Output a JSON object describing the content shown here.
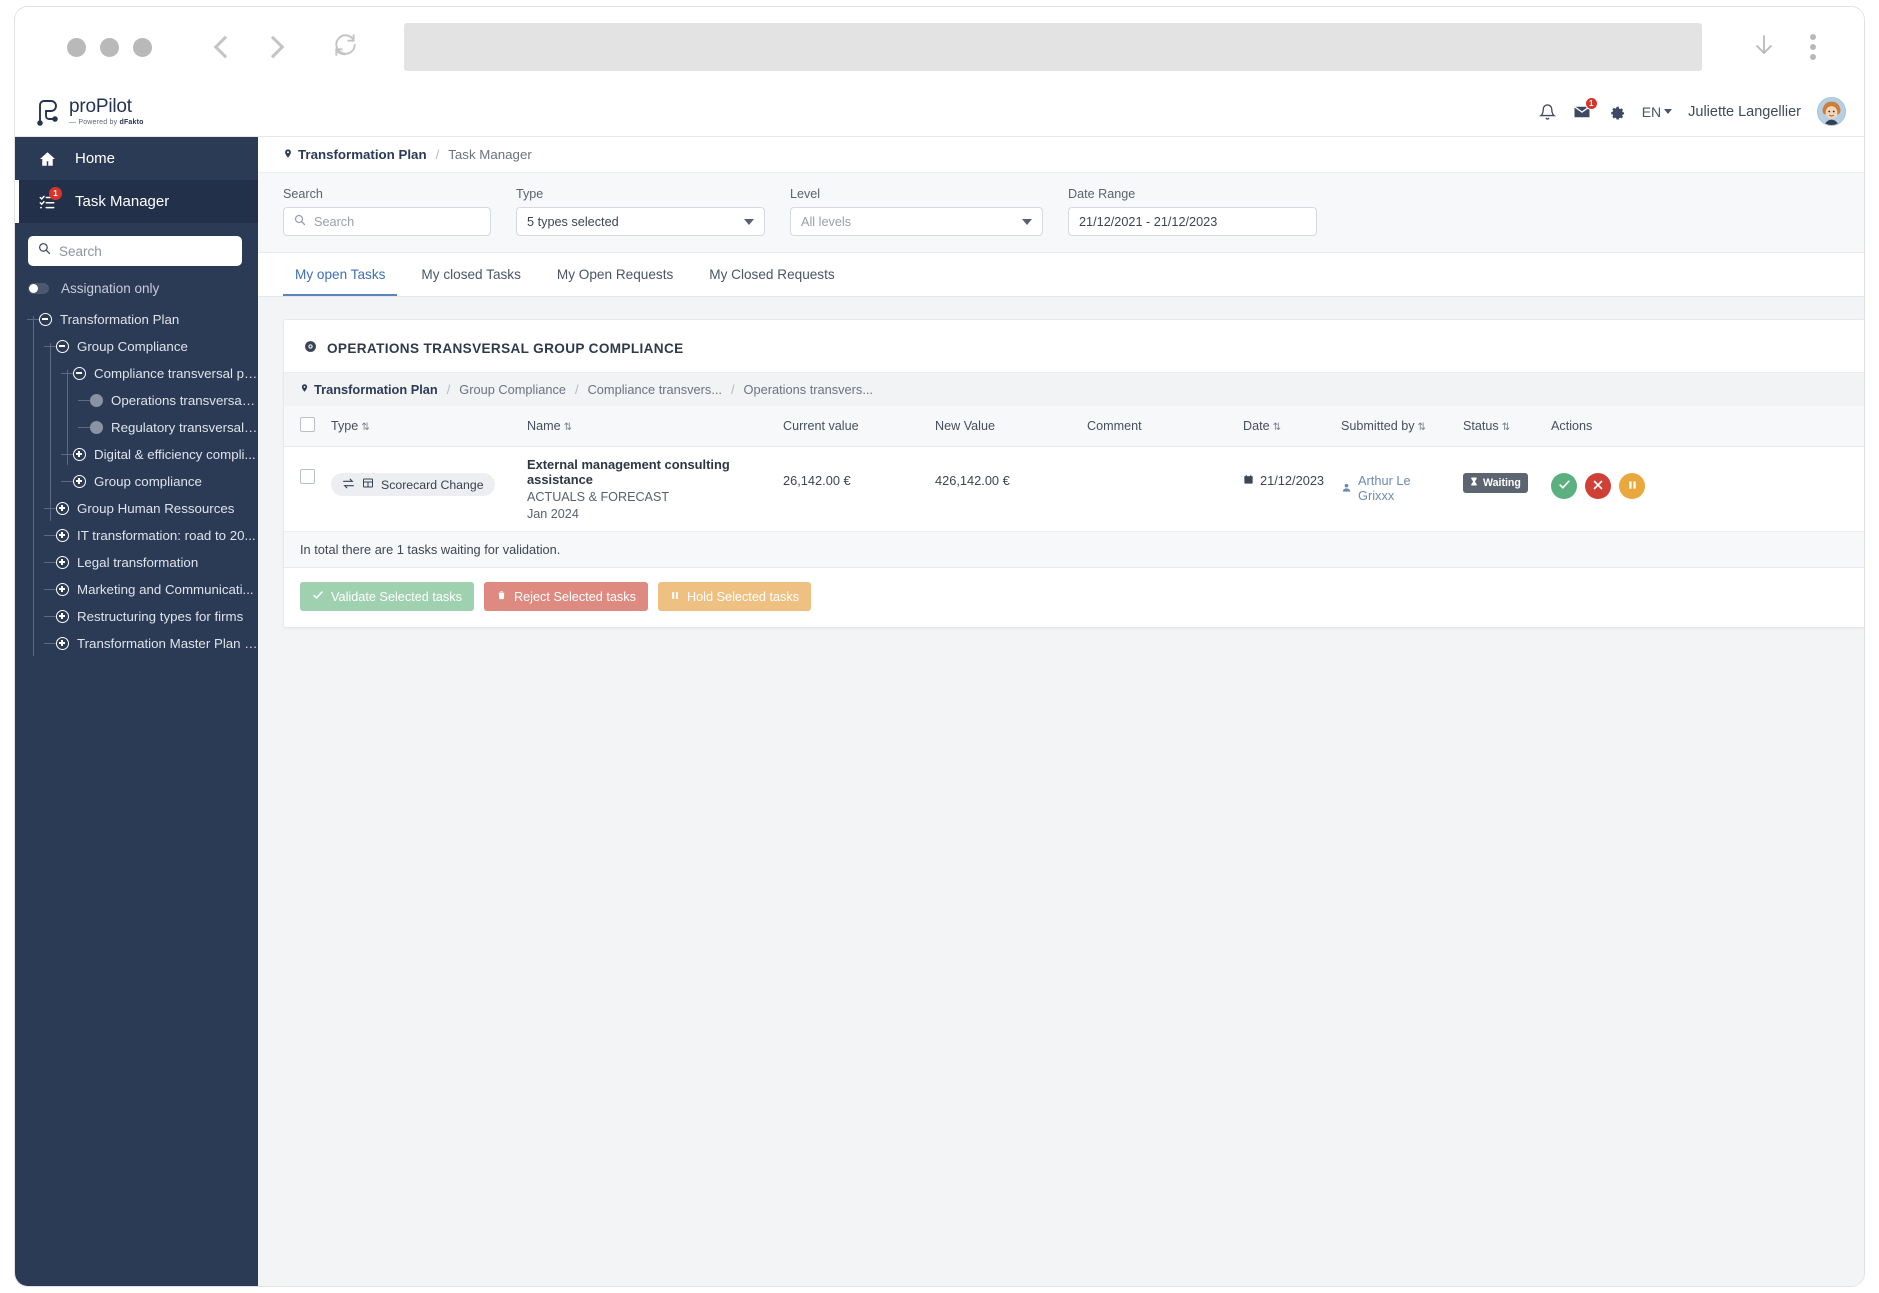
{
  "browser": {
    "back_label": "Back",
    "forward_label": "Forward",
    "reload_label": "Reload",
    "url_value": "",
    "download_label": "Downloads",
    "menu_label": "More"
  },
  "app": {
    "logo_name": "proPilot",
    "logo_sub_pre": "— Powered by ",
    "logo_sub_brand": "dFakto",
    "language": "EN",
    "username": "Juliette Langellier",
    "mail_badge": "1"
  },
  "sidebar": {
    "top_items": [
      {
        "label": "Home",
        "icon": "home-icon",
        "badge": ""
      },
      {
        "label": "Task Manager",
        "icon": "task-list-icon",
        "badge": "1"
      }
    ],
    "search_placeholder": "Search",
    "search_value": "",
    "assignation_label": "Assignation only",
    "tree": [
      {
        "label": "Transformation Plan",
        "depth": 0,
        "state": "minus"
      },
      {
        "label": "Group Compliance",
        "depth": 1,
        "state": "minus"
      },
      {
        "label": "Compliance transversal pr...",
        "depth": 2,
        "state": "minus"
      },
      {
        "label": "Operations transversal ...",
        "depth": 3,
        "state": "leaf"
      },
      {
        "label": "Regulatory transversal ...",
        "depth": 3,
        "state": "leaf"
      },
      {
        "label": "Digital & efficiency compli...",
        "depth": 2,
        "state": "plus"
      },
      {
        "label": "Group compliance",
        "depth": 2,
        "state": "plus"
      },
      {
        "label": "Group Human Ressources",
        "depth": 1,
        "state": "plus"
      },
      {
        "label": "IT transformation: road to 20...",
        "depth": 1,
        "state": "plus"
      },
      {
        "label": "Legal transformation",
        "depth": 1,
        "state": "plus"
      },
      {
        "label": "Marketing and Communicati...",
        "depth": 1,
        "state": "plus"
      },
      {
        "label": "Restructuring types for firms",
        "depth": 1,
        "state": "plus"
      },
      {
        "label": "Transformation Master Plan -...",
        "depth": 1,
        "state": "plus"
      }
    ]
  },
  "breadcrumb": {
    "root": "Transformation Plan",
    "sep": "/",
    "current": "Task Manager"
  },
  "filters": {
    "search": {
      "label": "Search",
      "placeholder": "Search",
      "value": ""
    },
    "type": {
      "label": "Type",
      "value": "5 types selected"
    },
    "level": {
      "label": "Level",
      "value": "All levels"
    },
    "date_range": {
      "label": "Date Range",
      "value": "21/12/2021 - 21/12/2023"
    }
  },
  "tabs": [
    {
      "label": "My open Tasks",
      "active": true
    },
    {
      "label": "My closed Tasks",
      "active": false
    },
    {
      "label": "My Open Requests",
      "active": false
    },
    {
      "label": "My Closed Requests",
      "active": false
    }
  ],
  "card": {
    "title": "OPERATIONS TRANSVERSAL GROUP COMPLIANCE",
    "breadcrumb": [
      "Transformation Plan",
      "Group Compliance",
      "Compliance transvers...",
      "Operations transvers..."
    ],
    "columns": [
      {
        "label": "Type",
        "sortable": true
      },
      {
        "label": "Name",
        "sortable": true
      },
      {
        "label": "Current value",
        "sortable": false
      },
      {
        "label": "New Value",
        "sortable": false
      },
      {
        "label": "Comment",
        "sortable": false
      },
      {
        "label": "Date",
        "sortable": true
      },
      {
        "label": "Submitted by",
        "sortable": true
      },
      {
        "label": "Status",
        "sortable": true
      },
      {
        "label": "Actions",
        "sortable": false
      }
    ],
    "rows": [
      {
        "type": "Scorecard Change",
        "name_title": "External management consulting assistance",
        "name_sub": "ACTUALS & FORECAST",
        "name_period": "Jan 2024",
        "current_value": "26,142.00 €",
        "new_value": "426,142.00 €",
        "comment": "",
        "date": "21/12/2023",
        "submitted_by": "Arthur Le Grixxx",
        "status": "Waiting"
      }
    ],
    "total_text": "In total there are 1 tasks waiting for validation.",
    "bulk_actions": [
      {
        "label": "Validate Selected tasks",
        "kind": "validate",
        "icon": "check-icon"
      },
      {
        "label": "Reject Selected tasks",
        "kind": "reject",
        "icon": "trash-icon"
      },
      {
        "label": "Hold Selected tasks",
        "kind": "hold",
        "icon": "pause-icon"
      }
    ]
  },
  "colors": {
    "sidebar_bg": "#2b3a55",
    "accent_blue": "#3f6fb5",
    "validate_green": "#5cb07f",
    "reject_red": "#cf4136",
    "hold_orange": "#e8a83e",
    "badge_red": "#d9342b",
    "status_gray": "#5d6570"
  }
}
